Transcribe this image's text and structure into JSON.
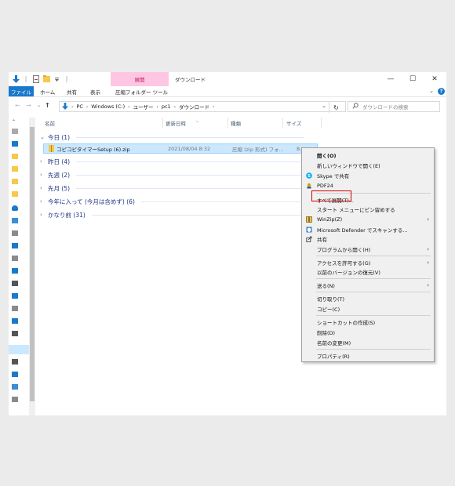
{
  "titlebar": {
    "context_tab": "展開",
    "window_title": "ダウンロード",
    "minimize": "—",
    "maximize": "☐",
    "close": "✕"
  },
  "ribbon": {
    "tabs": [
      "ファイル",
      "ホーム",
      "共有",
      "表示",
      "圧縮フォルダー ツール"
    ],
    "expand": "⌄",
    "help": "?"
  },
  "address": {
    "back": "←",
    "forward": "→",
    "recent": "⌄",
    "up": "↑",
    "breadcrumbs": [
      "PC",
      "Windows (C:)",
      "ユーザー",
      "pc1",
      "ダウンロード"
    ],
    "dropdown": "⌄",
    "refresh": "↻",
    "search_placeholder": "ダウンロードの検索"
  },
  "columns": [
    "名前",
    "更新日時",
    "種類",
    "サイズ"
  ],
  "groups": [
    {
      "label": "今日 (1)",
      "expanded": true
    },
    {
      "label": "昨日 (4)",
      "expanded": false
    },
    {
      "label": "先週 (2)",
      "expanded": false
    },
    {
      "label": "先月 (5)",
      "expanded": false
    },
    {
      "label": "今年に入って (今月は含めず) (6)",
      "expanded": false
    },
    {
      "label": "かなり前 (31)",
      "expanded": false
    }
  ],
  "file": {
    "name": "コピコピタイマーSetup (6).zip",
    "modified": "2021/08/04 8:32",
    "type": "圧縮 (zip 形式) フォ...",
    "size": "8..."
  },
  "context_menu": {
    "items": [
      {
        "label": "開く(O)",
        "bold": true
      },
      {
        "label": "新しいウィンドウで開く(E)"
      },
      {
        "label": "Skype で共有",
        "icon": "skype-icon"
      },
      {
        "label": "PDF24",
        "icon": "pdf24-icon"
      },
      {
        "label": "すべて展開(T)...",
        "highlighted": true
      },
      {
        "label": "スタート メニューにピン留めする"
      },
      {
        "label": "WinZip(Z)",
        "icon": "winzip-icon",
        "submenu": true
      },
      {
        "label": "Microsoft Defender でスキャンする...",
        "icon": "defender-icon"
      },
      {
        "label": "共有",
        "icon": "share-icon"
      },
      {
        "label": "プログラムから開く(H)",
        "submenu": true
      },
      {
        "label": "アクセスを許可する(G)",
        "submenu": true
      },
      {
        "label": "以前のバージョンの復元(V)"
      },
      {
        "label": "送る(N)",
        "submenu": true
      },
      {
        "label": "切り取り(T)"
      },
      {
        "label": "コピー(C)"
      },
      {
        "label": "ショートカットの作成(S)"
      },
      {
        "label": "削除(D)"
      },
      {
        "label": "名前の変更(M)"
      },
      {
        "label": "プロパティ(R)"
      }
    ],
    "submenu_arrow": "›"
  },
  "colors": {
    "accent": "#1979ca",
    "selection": "#cce8ff",
    "context_tab": "#ffc6e3",
    "highlight_box": "#d00000"
  }
}
